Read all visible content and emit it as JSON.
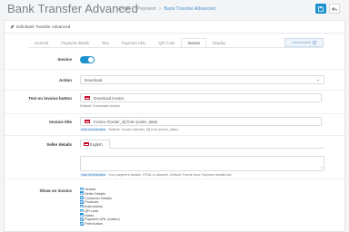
{
  "header": {
    "title": "Bank Transfer Advanced",
    "breadcrumb": [
      "Home",
      "Payment",
      "Bank Transfer Advanced"
    ]
  },
  "panel": {
    "heading": "Edit Bank Transfer Advanced",
    "tabs": [
      "General",
      "Payment details",
      "Text",
      "Payment URL",
      "QR Code",
      "Invoice",
      "Display"
    ],
    "active_tab": "Invoice",
    "view_button": "View invoice"
  },
  "form": {
    "invoice": {
      "label": "Invoice",
      "enabled": true
    },
    "action": {
      "label": "Action",
      "value": "Download"
    },
    "invoice_button": {
      "label": "Text on invoice button",
      "value": "Download invoice",
      "help": "Default: Download invoice"
    },
    "invoice_title": {
      "label": "Invoice title",
      "value": "Invoice #{order_id} from {order_date}",
      "badge": "Use shortcodes",
      "help": "Default: Invoice #{order_id} from {order_date}"
    },
    "seller_details": {
      "label": "Seller details",
      "language": "English",
      "badge": "Use shortcodes",
      "help": "Your payment details, HTML is allowed. Default: Feeds from Payment details tab"
    },
    "show_on_invoice": {
      "label": "Show on invoice",
      "items": [
        "Header",
        "Seller Details",
        "Customer Details",
        "Products",
        "Instructions",
        "QR code",
        "Notes",
        "Payment URL (button)",
        "Print button"
      ]
    }
  },
  "colors": {
    "primary": "#1e91cf",
    "link": "#4a94d6"
  }
}
